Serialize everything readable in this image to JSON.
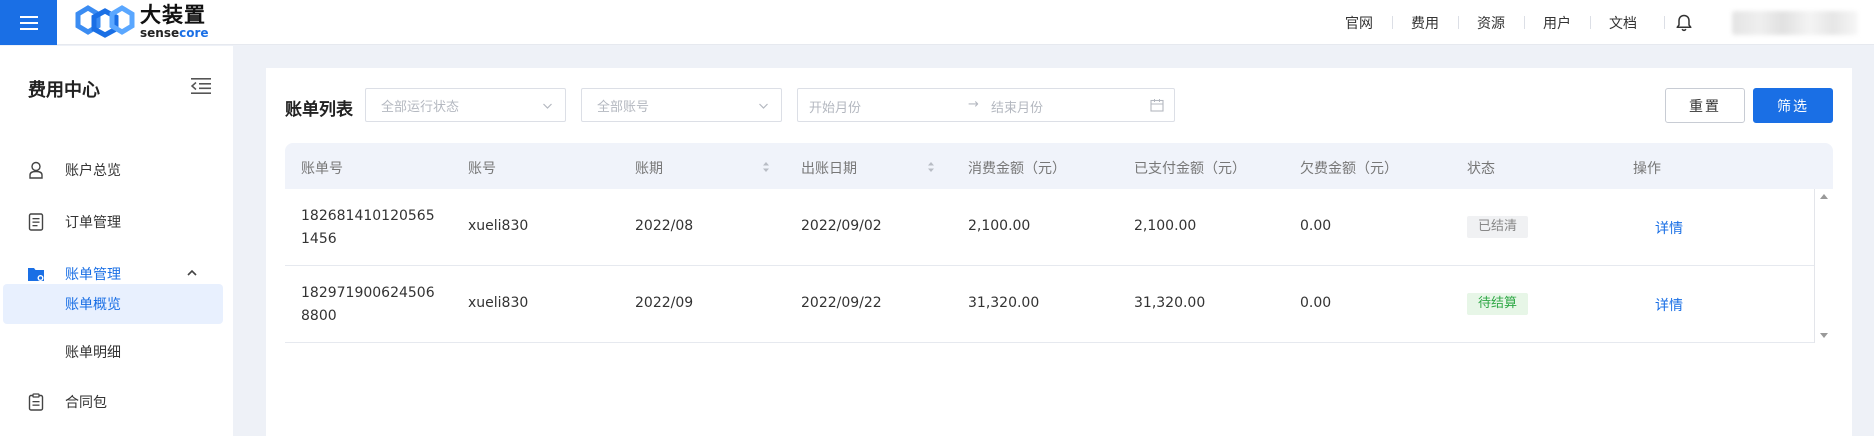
{
  "header": {
    "logo_cn": "大装置",
    "logo_en_part1": "sense",
    "logo_en_part2": "core",
    "nav": [
      "官网",
      "费用",
      "资源",
      "用户",
      "文档"
    ]
  },
  "sidebar": {
    "title": "费用中心",
    "items": [
      {
        "label": "账户总览",
        "icon": "user-icon"
      },
      {
        "label": "订单管理",
        "icon": "document-icon"
      },
      {
        "label": "账单管理",
        "icon": "folder-icon",
        "expanded": true,
        "children": [
          {
            "label": "账单概览",
            "active": true
          },
          {
            "label": "账单明细",
            "active": false
          }
        ]
      },
      {
        "label": "合同包",
        "icon": "clipboard-icon"
      }
    ]
  },
  "filters": {
    "label": "账单列表",
    "status_placeholder": "全部运行状态",
    "account_placeholder": "全部账号",
    "start_month_placeholder": "开始月份",
    "range_separator": "→",
    "end_month_placeholder": "结束月份",
    "reset_label": "重置",
    "filter_label": "筛选"
  },
  "table": {
    "columns": [
      "账单号",
      "账号",
      "账期",
      "出账日期",
      "消费金额（元）",
      "已支付金额（元）",
      "欠费金额（元）",
      "状态",
      "操作"
    ],
    "rows": [
      {
        "bill_no": "1826814101205651456",
        "account": "xueli830",
        "period": "2022/08",
        "date": "2022/09/02",
        "amount": "2,100.00",
        "paid": "2,100.00",
        "owed": "0.00",
        "status": "已结清",
        "status_type": "settled",
        "action": "详情"
      },
      {
        "bill_no": "1829719006245068800",
        "account": "xueli830",
        "period": "2022/09",
        "date": "2022/09/22",
        "amount": "31,320.00",
        "paid": "31,320.00",
        "owed": "0.00",
        "status": "待结算",
        "status_type": "pending",
        "action": "详情"
      }
    ]
  },
  "colors": {
    "primary": "#1a6fe5",
    "settled_bg": "#f0f1f3",
    "pending_text": "#2fa846"
  }
}
